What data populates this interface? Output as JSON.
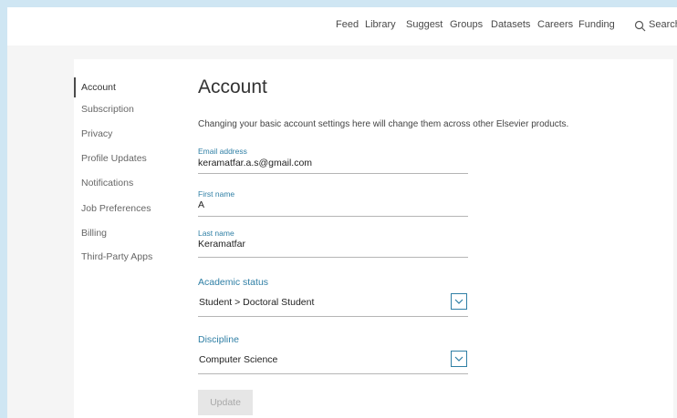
{
  "topnav": {
    "items": [
      "Feed",
      "Library",
      "Suggest",
      "Groups",
      "Datasets",
      "Careers",
      "Funding"
    ],
    "search_label": "Search"
  },
  "sidebar": {
    "items": [
      {
        "label": "Account",
        "active": true
      },
      {
        "label": "Subscription"
      },
      {
        "label": "Privacy"
      },
      {
        "label": "Profile Updates"
      },
      {
        "label": "Notifications"
      },
      {
        "label": "Job Preferences"
      },
      {
        "label": "Billing"
      },
      {
        "label": "Third-Party Apps"
      }
    ]
  },
  "main": {
    "title": "Account",
    "intro": "Changing your basic account settings here will change them across other Elsevier products.",
    "fields": [
      {
        "label": "Email address",
        "value": "keramatfar.a.s@gmail.com"
      },
      {
        "label": "First name",
        "value": "A"
      },
      {
        "label": "Last name",
        "value": "Keramatfar"
      }
    ],
    "selects": [
      {
        "label": "Academic status",
        "value": "Student > Doctoral Student"
      },
      {
        "label": "Discipline",
        "value": "Computer Science"
      }
    ],
    "update_label": "Update"
  },
  "colors": {
    "accent": "#2f7fa5",
    "background": "#cfe6f3"
  }
}
